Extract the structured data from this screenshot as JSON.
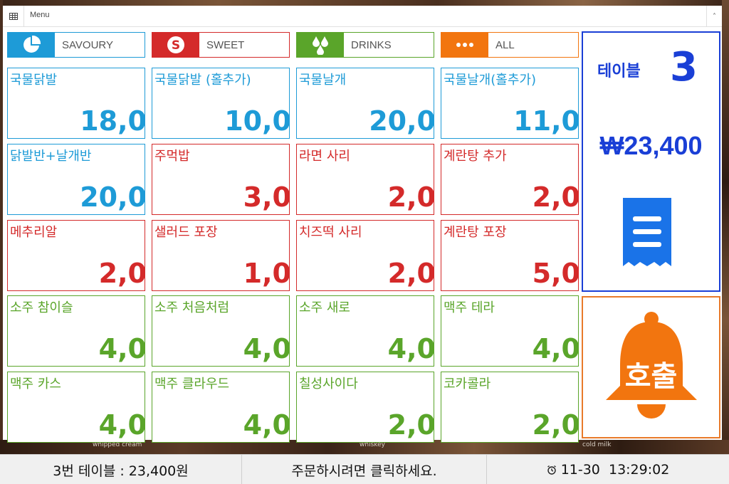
{
  "window": {
    "title": "Menu"
  },
  "colors": {
    "savoury": "#1e9bd7",
    "sweet": "#d42a2a",
    "drinks": "#5aa52a",
    "all": "#f2750f",
    "table": "#1a3fd6",
    "call": "#f2750f"
  },
  "tabs": [
    {
      "label": "SAVOURY",
      "icon": "pie-chart-icon",
      "color": "#1e9bd7"
    },
    {
      "label": "SWEET",
      "icon": "skype-icon",
      "color": "#d42a2a"
    },
    {
      "label": "DRINKS",
      "icon": "droplets-icon",
      "color": "#5aa52a"
    },
    {
      "label": "ALL",
      "icon": "more-dots-icon",
      "color": "#f2750f"
    }
  ],
  "menu": [
    {
      "name": "국물닭발",
      "price": "18,0",
      "color": "#1e9bd7"
    },
    {
      "name": "국물닭발 (홀추가)",
      "price": "10,0",
      "color": "#1e9bd7"
    },
    {
      "name": "국물날개",
      "price": "20,0",
      "color": "#1e9bd7"
    },
    {
      "name": "국물날개(홀추가)",
      "price": "11,0",
      "color": "#1e9bd7"
    },
    {
      "name": "닭발반+날개반",
      "price": "20,0",
      "color": "#1e9bd7"
    },
    {
      "name": "주먹밥",
      "price": "3,0",
      "color": "#d42a2a"
    },
    {
      "name": "라면 사리",
      "price": "2,0",
      "color": "#d42a2a"
    },
    {
      "name": "계란탕 추가",
      "price": "2,0",
      "color": "#d42a2a"
    },
    {
      "name": "메추리알",
      "price": "2,0",
      "color": "#d42a2a"
    },
    {
      "name": "샐러드 포장",
      "price": "1,0",
      "color": "#d42a2a"
    },
    {
      "name": "치즈떡 사리",
      "price": "2,0",
      "color": "#d42a2a"
    },
    {
      "name": "계란탕 포장",
      "price": "5,0",
      "color": "#d42a2a"
    },
    {
      "name": "소주 참이슬",
      "price": "4,0",
      "color": "#5aa52a"
    },
    {
      "name": "소주 처음처럼",
      "price": "4,0",
      "color": "#5aa52a"
    },
    {
      "name": "소주 새로",
      "price": "4,0",
      "color": "#5aa52a"
    },
    {
      "name": "맥주 테라",
      "price": "4,0",
      "color": "#5aa52a"
    },
    {
      "name": "맥주 카스",
      "price": "4,0",
      "color": "#5aa52a"
    },
    {
      "name": "맥주 클라우드",
      "price": "4,0",
      "color": "#5aa52a"
    },
    {
      "name": "칠성사이다",
      "price": "2,0",
      "color": "#5aa52a"
    },
    {
      "name": "코카콜라",
      "price": "2,0",
      "color": "#5aa52a"
    }
  ],
  "table_panel": {
    "label": "테이블",
    "number": "3",
    "total": "₩23,400",
    "icon": "receipt-icon"
  },
  "call_panel": {
    "label": "호출",
    "icon": "bell-icon"
  },
  "background_text": {
    "left": "whipped cream",
    "mid": "whiskey",
    "right": "cold milk"
  },
  "status": {
    "table_summary": "3번 테이블 : 23,400원",
    "prompt": "주문하시려면 클릭하세요.",
    "datetime": "11-30  13:29:02",
    "clock_icon": "alarm-clock-icon"
  }
}
